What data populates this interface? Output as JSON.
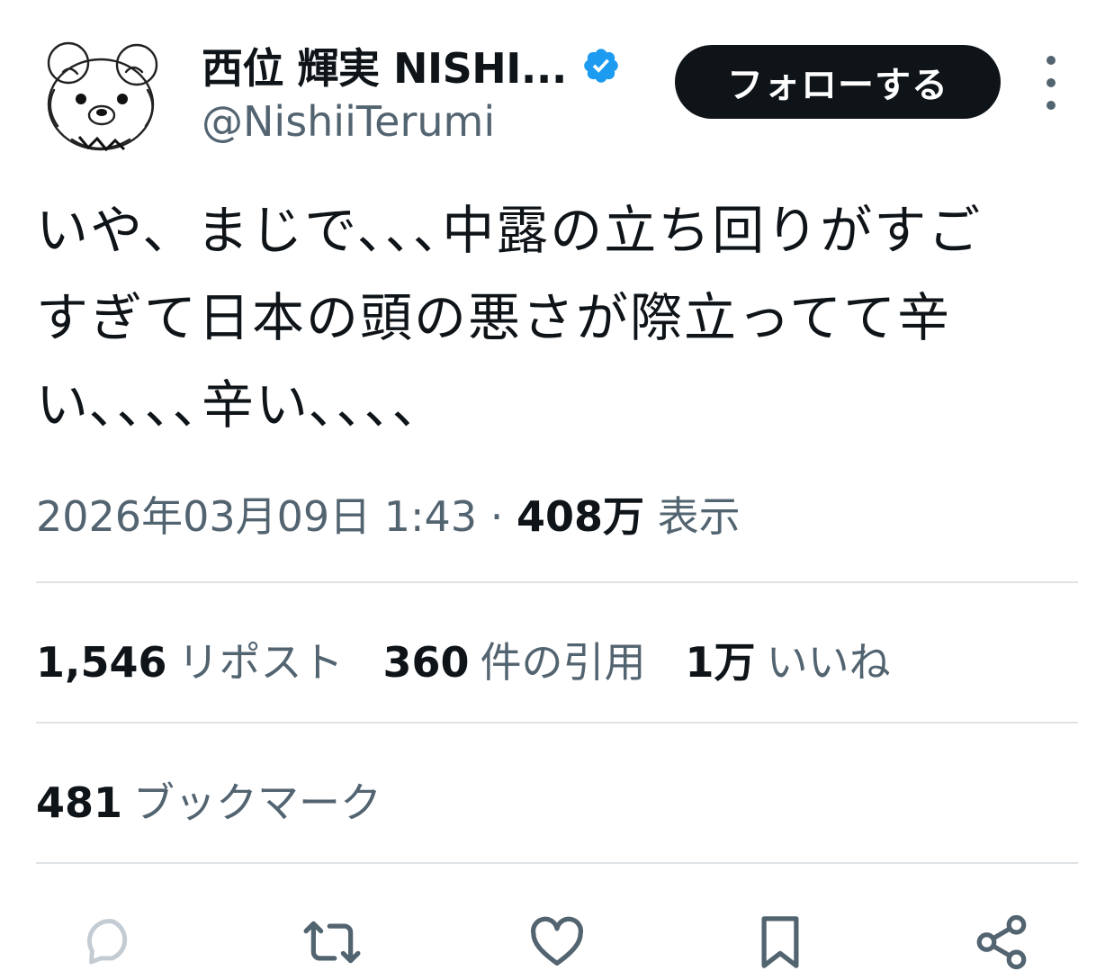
{
  "user": {
    "display_name": "西位 輝実 NISHI...",
    "handle": "@NishiiTerumi",
    "verified": true
  },
  "header": {
    "follow_label": "フォローする"
  },
  "tweet": {
    "text": "いや、まじで､､､中露の立ち回りがすご\nすぎて日本の頭の悪さが際立ってて辛\nい､､､､辛い､､､､",
    "date": "2026年03月09日 1:43",
    "separator": "·",
    "views_count": "408万",
    "views_label": "表示"
  },
  "stats": {
    "reposts": {
      "count": "1,546",
      "label": "リポスト"
    },
    "quotes": {
      "count": "360",
      "label": "件の引用"
    },
    "likes": {
      "count": "1万",
      "label": "いいね"
    },
    "bookmarks": {
      "count": "481",
      "label": "ブックマーク"
    }
  },
  "actions": [
    {
      "icon": "reply-icon"
    },
    {
      "icon": "repost-icon"
    },
    {
      "icon": "like-icon"
    },
    {
      "icon": "bookmark-icon"
    },
    {
      "icon": "share-icon"
    }
  ],
  "colors": {
    "text": "#0f1419",
    "secondary": "#536471",
    "verified": "#1d9bf0",
    "divider": "#dfe3e6"
  }
}
